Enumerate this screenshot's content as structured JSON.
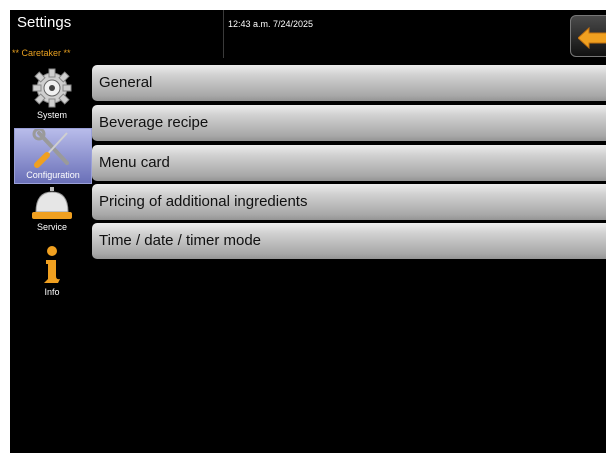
{
  "header": {
    "title": "Settings",
    "role": "** Caretaker **",
    "datetime": "12:43 a.m. 7/24/2025",
    "back_icon": "back-arrow-icon"
  },
  "sidebar": {
    "items": [
      {
        "label": "System",
        "icon": "gear-icon",
        "active": false
      },
      {
        "label": "Configuration",
        "icon": "wrench-screwdriver-icon",
        "active": true
      },
      {
        "label": "Service",
        "icon": "service-bell-icon",
        "active": false
      },
      {
        "label": "Info",
        "icon": "info-icon",
        "active": false
      }
    ]
  },
  "menu": {
    "items": [
      {
        "label": "General"
      },
      {
        "label": "Beverage recipe"
      },
      {
        "label": "Menu card"
      },
      {
        "label": "Pricing of additional ingredients"
      },
      {
        "label": "Time / date / timer mode"
      }
    ]
  },
  "colors": {
    "background": "#000000",
    "role_text": "#e8a020",
    "active_item": "#8a90d0",
    "back_arrow": "#f0a020"
  }
}
